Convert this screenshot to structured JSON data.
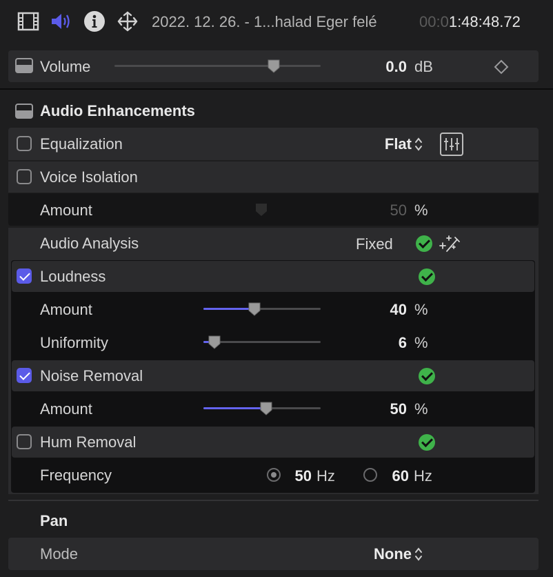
{
  "header": {
    "title": "2022. 12. 26. - 1...halad Eger felé",
    "timecode_dim": "00:0",
    "timecode": "1:48:48.72",
    "icons": [
      "film-icon",
      "speaker-icon",
      "info-icon",
      "transform-icon"
    ]
  },
  "volume": {
    "label": "Volume",
    "value": "0.0",
    "unit": "dB",
    "slider_level": 0.77
  },
  "enhancements": {
    "title": "Audio Enhancements",
    "equalization": {
      "label": "Equalization",
      "checked": false,
      "preset": "Flat"
    },
    "voice_isolation": {
      "label": "Voice Isolation",
      "checked": false
    },
    "voice_amount": {
      "label": "Amount",
      "value": "50",
      "unit": "%"
    },
    "audio_analysis": {
      "label": "Audio Analysis",
      "status": "Fixed"
    },
    "loudness": {
      "label": "Loudness",
      "checked": true
    },
    "loudness_amount": {
      "label": "Amount",
      "value": "40",
      "unit": "%",
      "level": 0.4
    },
    "uniformity": {
      "label": "Uniformity",
      "value": "6",
      "unit": "%",
      "level": 0.06
    },
    "noise_removal": {
      "label": "Noise Removal",
      "checked": true
    },
    "noise_amount": {
      "label": "Amount",
      "value": "50",
      "unit": "%",
      "level": 0.5
    },
    "hum_removal": {
      "label": "Hum Removal",
      "checked": false
    },
    "frequency": {
      "label": "Frequency",
      "opt1": "50",
      "opt2": "60",
      "unit": "Hz",
      "selected": "50"
    }
  },
  "pan": {
    "title": "Pan",
    "mode_label": "Mode",
    "mode_value": "None"
  },
  "colors": {
    "accent": "#5b5be8",
    "slider_fill": "#6363ee",
    "ok_green": "#3fb24a",
    "panel": "#2b2b2d"
  }
}
